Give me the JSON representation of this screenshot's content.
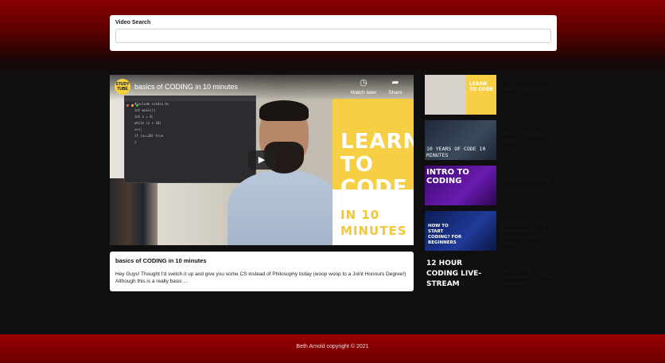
{
  "search": {
    "label": "Video Search",
    "value": "",
    "placeholder": ""
  },
  "player": {
    "channel_logo_text": "STUDY TUBE",
    "title": "basics of CODING in 10 minutes",
    "watch_later_label": "Watch later",
    "share_label": "Share",
    "thumbnail_text_main": "LEARN TO CODE",
    "thumbnail_text_sub": "IN 10 MINUTES",
    "code_lines": [
      "#include <stdio.h>",
      "int main(){",
      "  int x = 0;",
      "  while (x < 10)",
      "    x++;",
      "  if (x==10) true",
      "}"
    ]
  },
  "selected_video": {
    "title": "basics of CODING in 10 minutes",
    "description": "Hey Guys! Thought I'd switch it up and give you some CS instead of Philosophy today (woop woop to a Joint Honours Degree!) Although this is a really basic ..."
  },
  "related_videos": [
    {
      "title": "basics of CODING in 10 minutes",
      "thumb_text": "LEARN TO CODE"
    },
    {
      "title": "10 Years of Coding in 10 Minutes",
      "thumb_text": "10 YEARS OF CODE 10 MINUTES"
    },
    {
      "title": "Introduction to Coding",
      "thumb_text": "INTRO TO CODING"
    },
    {
      "title": "How to Start Coding | Programming for Beginners | Learn Coding",
      "thumb_text": "HOW TO START CODING? FOR BEGINNERS"
    },
    {
      "title": "Learn Coding Fundamentals - 12 Hour Livestream Part 1",
      "thumb_text": "12 HOUR CODING LIVE-STREAM"
    }
  ],
  "footer": {
    "text": "Beth Arnold copyright © 2021"
  }
}
